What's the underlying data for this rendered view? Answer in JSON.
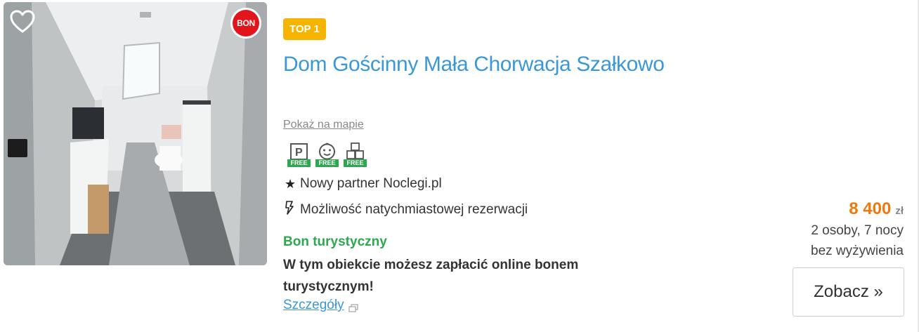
{
  "listing": {
    "badge_top": "TOP 1",
    "bon_badge": "BON",
    "title": "Dom Gościnny Mała Chorwacja Szałkowo",
    "map_link": "Pokaż na mapie",
    "amenities": [
      {
        "icon": "parking-icon",
        "label": "FREE"
      },
      {
        "icon": "baby-face-icon",
        "label": "FREE"
      },
      {
        "icon": "blocks-icon",
        "label": "FREE"
      }
    ],
    "features": {
      "partner": "Nowy partner Noclegi.pl",
      "instant": "Możliwość natychmiastowej rezerwacji"
    },
    "voucher": {
      "title": "Bon turystyczny",
      "text": "W tym obiekcie możesz zapłacić online bonem turystycznym!",
      "details_link": "Szczegóły"
    },
    "price": {
      "amount": "8 400",
      "currency": "zł",
      "persons": "2 osoby, 7 nocy",
      "board": "bez wyżywienia"
    },
    "cta": "Zobacz »"
  },
  "colors": {
    "title": "#3a98d8",
    "top_badge": "#f4b400",
    "bon_badge": "#e2141c",
    "voucher_green": "#2ea84f",
    "price": "#ee7a0e"
  }
}
